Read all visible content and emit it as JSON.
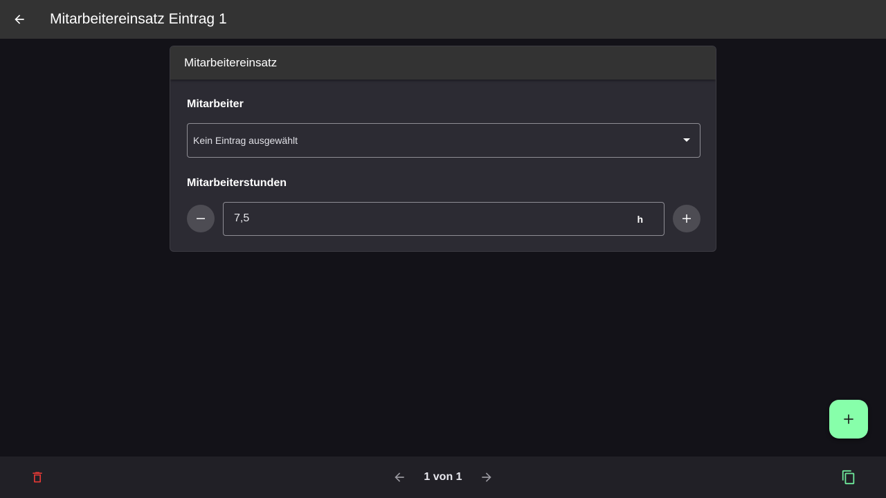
{
  "app_bar": {
    "title": "Mitarbeitereinsatz Eintrag 1",
    "back_icon": "arrow-left-icon"
  },
  "card": {
    "header": "Mitarbeitereinsatz",
    "employee": {
      "label": "Mitarbeiter",
      "selected_value": "Kein Eintrag ausgewählt"
    },
    "hours": {
      "label": "Mitarbeiterstunden",
      "value": "7,5",
      "unit": "h"
    }
  },
  "pagination": {
    "text": "1 von 1"
  },
  "colors": {
    "accent_green": "#87ffaa",
    "delete_red": "#e53935",
    "copy_green": "#6ee89a"
  },
  "icons": {
    "delete": "trash-icon",
    "prev": "arrow-left-icon",
    "next": "arrow-right-icon",
    "copy": "copy-icon",
    "add": "plus-icon",
    "decrement": "minus-icon",
    "increment": "plus-icon",
    "dropdown": "caret-down-icon"
  }
}
